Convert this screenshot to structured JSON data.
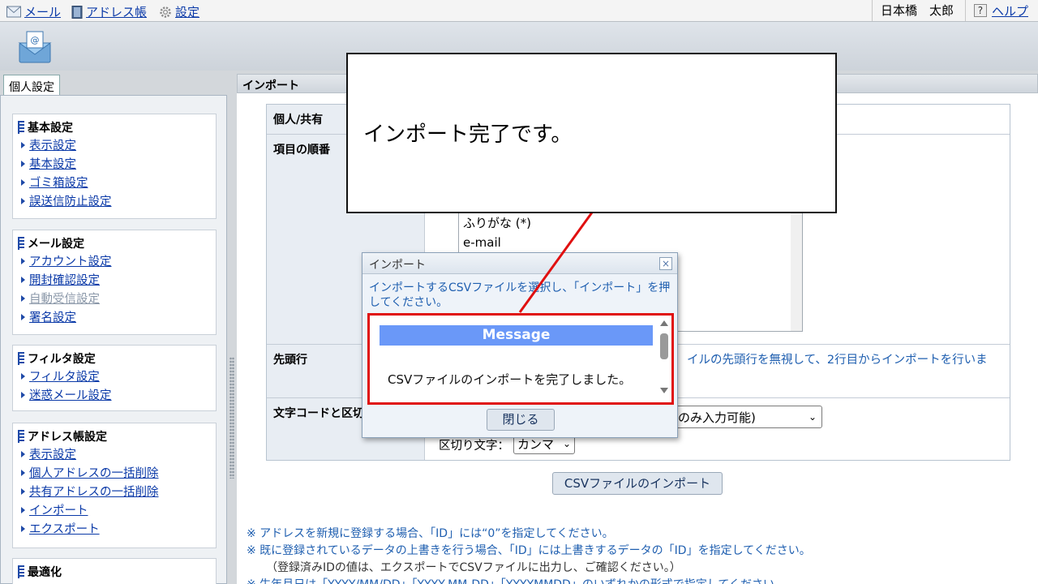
{
  "topbar": {
    "mail": "メール",
    "address_book": "アドレス帳",
    "settings": "設定",
    "user_name": "日本橋　太郎",
    "help": "ヘルプ"
  },
  "left": {
    "tab": "個人設定",
    "sections": [
      {
        "title": "基本設定",
        "items": [
          "表示設定",
          "基本設定",
          "ゴミ箱設定",
          "誤送信防止設定"
        ]
      },
      {
        "title": "メール設定",
        "items": [
          "アカウント設定",
          "開封確認設定",
          "自動受信設定",
          "署名設定"
        ]
      },
      {
        "title": "フィルタ設定",
        "items": [
          "フィルタ設定",
          "迷惑メール設定"
        ]
      },
      {
        "title": "アドレス帳設定",
        "items": [
          "表示設定",
          "個人アドレスの一括削除",
          "共有アドレスの一括削除",
          "インポート",
          "エクスポート"
        ]
      },
      {
        "title": "最適化",
        "items": []
      }
    ]
  },
  "main": {
    "title": "インポート",
    "rows": {
      "personal_shared": "個人/共有",
      "item_order": "項目の順番",
      "first_row": "先頭行",
      "charset": "文字コードと区切"
    },
    "list_items": [
      "ふりがな (*)",
      "e-mail"
    ],
    "first_row_desc": "イルの先頭行を無視して、2行目からインポートを行いま",
    "charset_select": "のみ入力可能)",
    "delimiter_label": "区切り文字：",
    "delimiter_value": "カンマ",
    "import_button": "CSVファイルのインポート",
    "notes": [
      "※ アドレスを新規に登録する場合、「ID」には“0”を指定してください。",
      "※ 既に登録されているデータの上書きを行う場合、「ID」には上書きするデータの「ID」を指定してください。",
      "（登録済みIDの値は、エクスポートでCSVファイルに出力し、ご確認ください。）",
      "※ 生年月日は「YYYY/MM/DD」「YYYY-MM-DD」「YYYYMMDD」のいずれかの形式で指定してください。"
    ]
  },
  "dialog": {
    "title": "インポート",
    "close_x": "×",
    "description": "インポートするCSVファイルを選択し、「インポート」を押してください。",
    "message_header": "Message",
    "message_text": "CSVファイルのインポートを完了しました。",
    "close_button": "閉じる"
  },
  "callout": {
    "text": "インポート完了です。"
  },
  "colors": {
    "highlight": "#e01010",
    "message_header": "#6a98f8",
    "link": "#0b3aa8"
  }
}
